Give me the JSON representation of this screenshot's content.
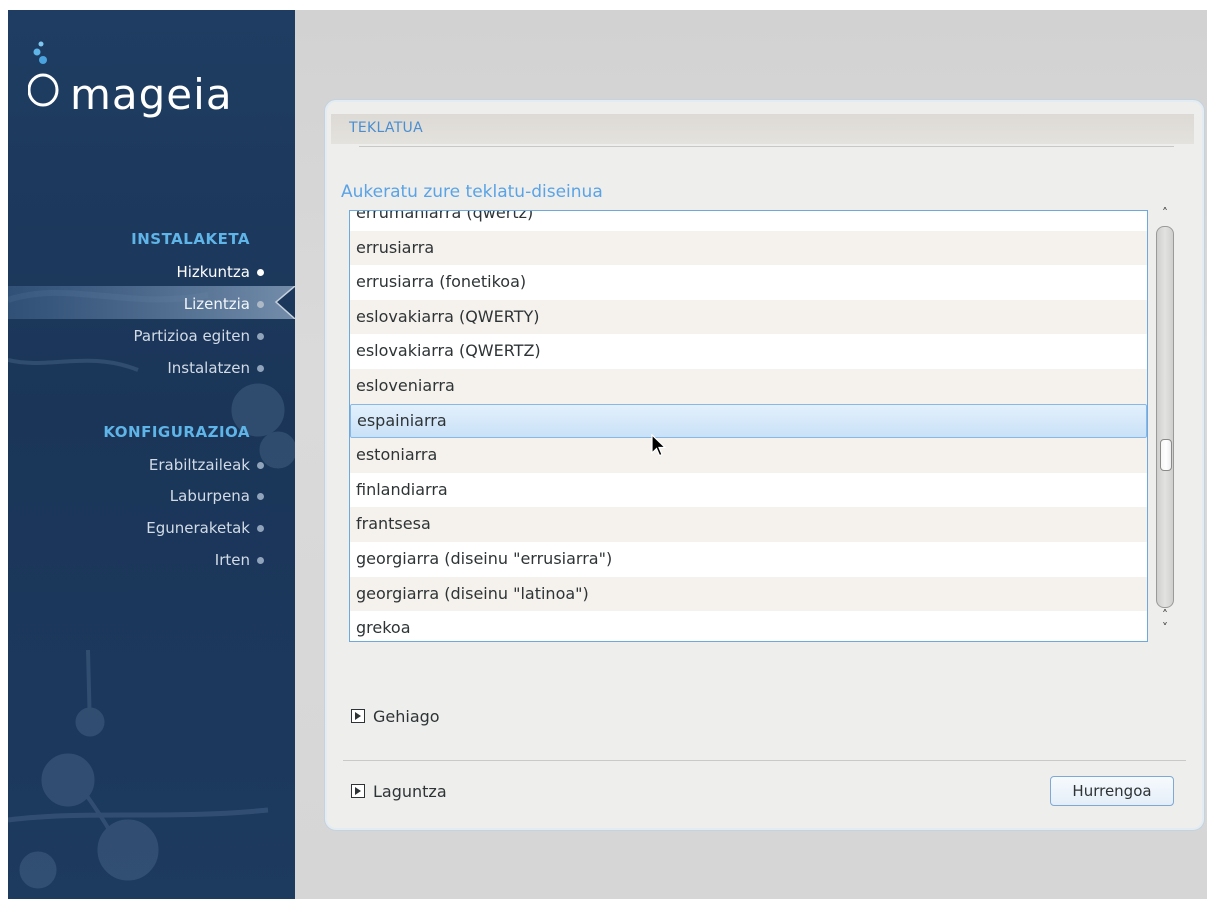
{
  "sidebar": {
    "logo_text": "mageia",
    "sections": [
      {
        "heading": "INSTALAKETA",
        "items": [
          {
            "label": "Hizkuntza",
            "state": "done"
          },
          {
            "label": "Lizentzia",
            "state": "active"
          },
          {
            "label": "Partizioa egiten",
            "state": "pending"
          },
          {
            "label": "Instalatzen",
            "state": "pending"
          }
        ]
      },
      {
        "heading": "KONFIGURAZIOA",
        "items": [
          {
            "label": "Erabiltzaileak",
            "state": "pending"
          },
          {
            "label": "Laburpena",
            "state": "pending"
          },
          {
            "label": "Eguneraketak",
            "state": "pending"
          },
          {
            "label": "Irten",
            "state": "pending"
          }
        ]
      }
    ]
  },
  "panel": {
    "title": "TEKLATUA",
    "prompt": "Aukeratu zure teklatu-diseinua",
    "layouts": [
      "errumaniarra (qwertz)",
      "errusiarra",
      "errusiarra (fonetikoa)",
      "eslovakiarra (QWERTY)",
      "eslovakiarra (QWERTZ)",
      "esloveniarra",
      "espainiarra",
      "estoniarra",
      "finlandiarra",
      "frantsesa",
      "georgiarra (diseinu \"errusiarra\")",
      "georgiarra (diseinu \"latinoa\")",
      "grekoa"
    ],
    "selected_layout": "espainiarra",
    "more_expander": "Gehiago",
    "help_expander": "Laguntza",
    "next_button": "Hurrengoa"
  },
  "colors": {
    "sidebar_bg": "#1d3a5f",
    "heading_blue": "#5fb4e8",
    "accent_blue": "#5aa3e6",
    "selection": "#c9e1f7"
  }
}
